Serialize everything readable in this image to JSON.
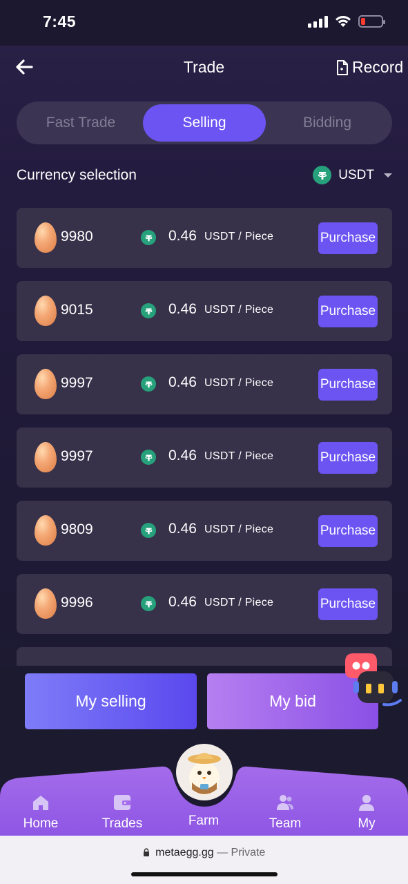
{
  "status": {
    "time": "7:45"
  },
  "header": {
    "title": "Trade",
    "record": "Record"
  },
  "tabs": [
    "Fast Trade",
    "Selling",
    "Bidding"
  ],
  "active_tab": "Selling",
  "currency": {
    "label": "Currency selection",
    "selected": "USDT"
  },
  "listings": [
    {
      "qty": "9980",
      "price": "0.46",
      "unit": "USDT / Piece",
      "action": "Purchase"
    },
    {
      "qty": "9015",
      "price": "0.46",
      "unit": "USDT / Piece",
      "action": "Purchase"
    },
    {
      "qty": "9997",
      "price": "0.46",
      "unit": "USDT / Piece",
      "action": "Purchase"
    },
    {
      "qty": "9997",
      "price": "0.46",
      "unit": "USDT / Piece",
      "action": "Purchase"
    },
    {
      "qty": "9809",
      "price": "0.46",
      "unit": "USDT / Piece",
      "action": "Purchase"
    },
    {
      "qty": "9996",
      "price": "0.46",
      "unit": "USDT / Piece",
      "action": "Purchase"
    }
  ],
  "actions": {
    "my_selling": "My selling",
    "my_bid": "My bid"
  },
  "nav": [
    {
      "label": "Home",
      "icon": "home-icon"
    },
    {
      "label": "Trades",
      "icon": "wallet-icon"
    },
    {
      "label": "Farm",
      "icon": "chicken-mascot-icon"
    },
    {
      "label": "Team",
      "icon": "team-icon"
    },
    {
      "label": "My",
      "icon": "user-icon"
    }
  ],
  "browser": {
    "domain": "metaegg.gg",
    "privacy": "— Private"
  },
  "colors": {
    "accent": "#6b54f2",
    "tether": "#26a17b",
    "nav": "#9a62e6"
  }
}
